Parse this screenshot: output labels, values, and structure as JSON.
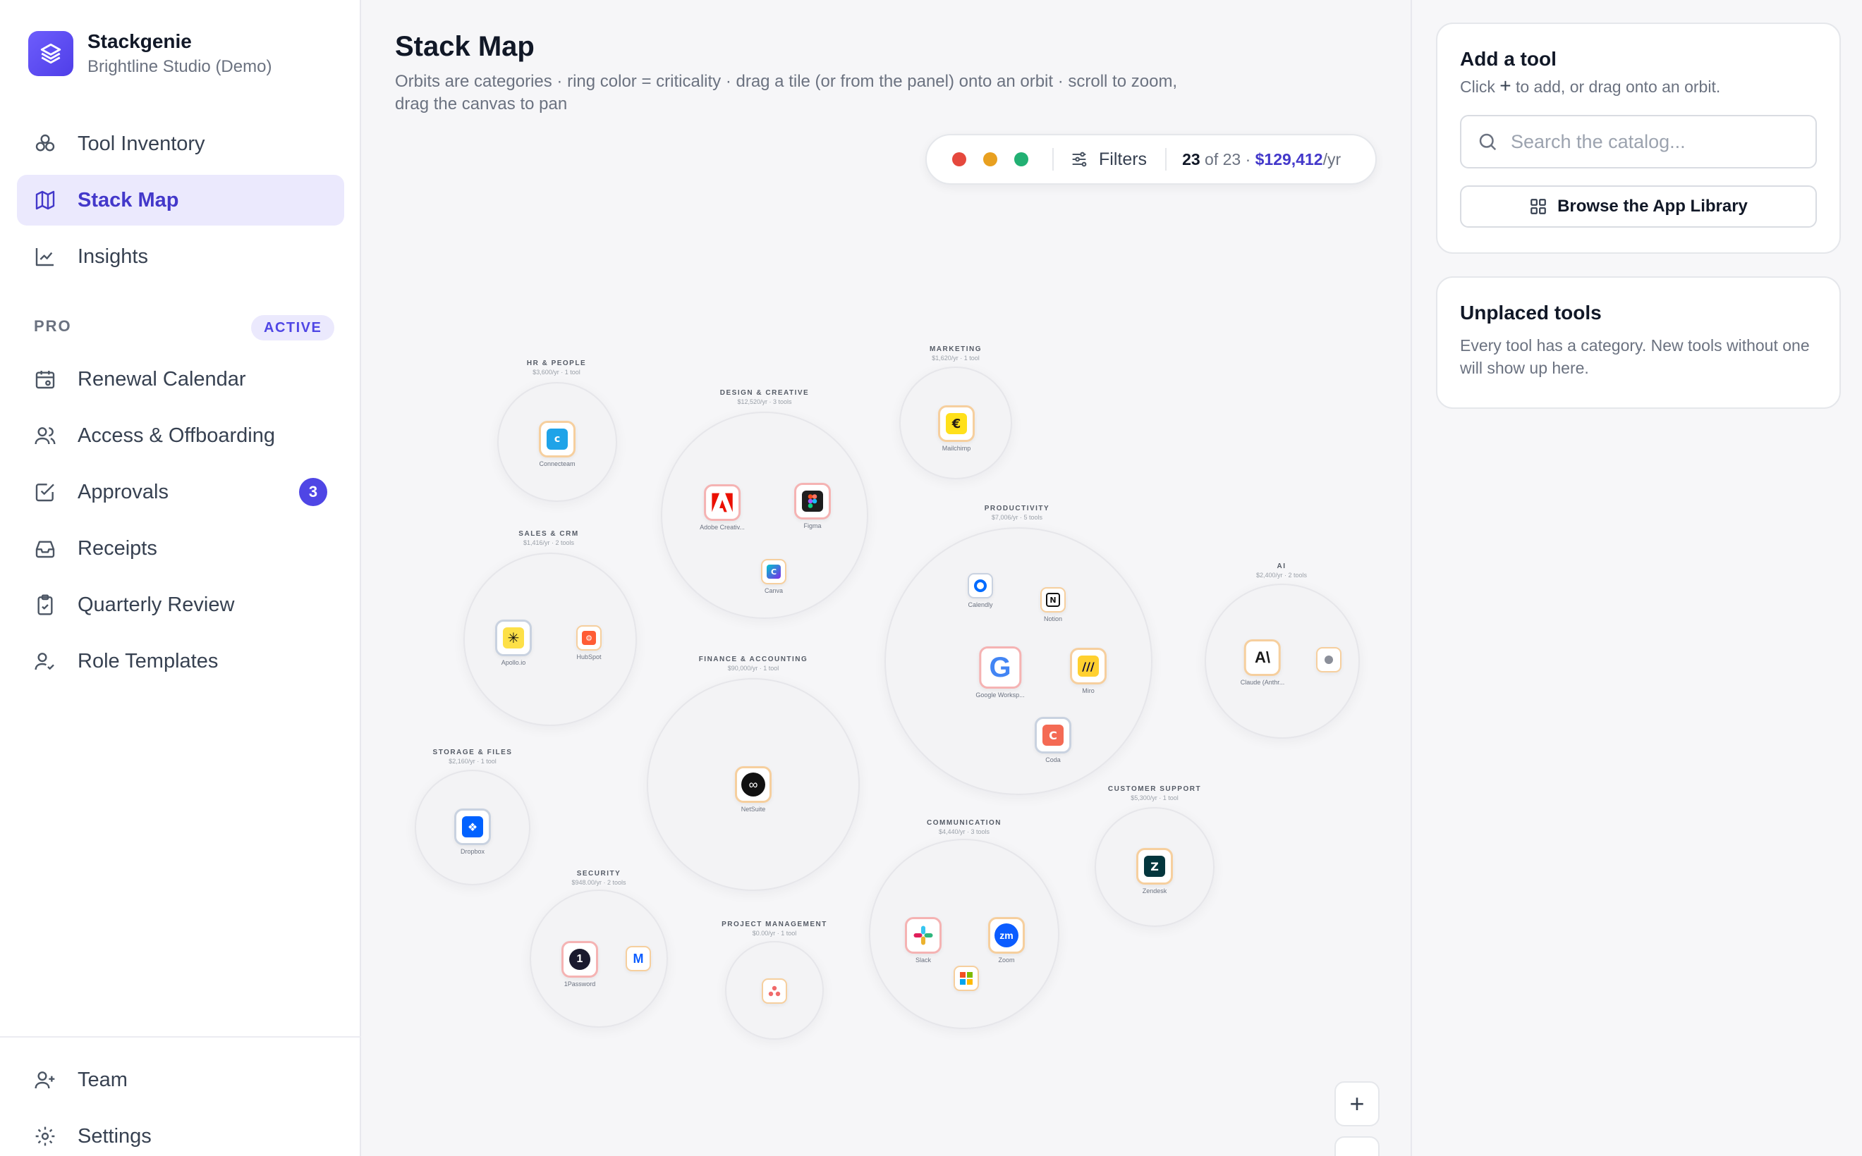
{
  "brand": {
    "name": "Stackgenie",
    "workspace": "Brightline Studio (Demo)"
  },
  "nav_main": [
    {
      "label": "Tool Inventory",
      "icon": "layers-circles-icon"
    },
    {
      "label": "Stack Map",
      "icon": "map-icon",
      "active": true
    },
    {
      "label": "Insights",
      "icon": "line-chart-icon"
    }
  ],
  "pro": {
    "label": "PRO",
    "status": "ACTIVE"
  },
  "nav_pro": [
    {
      "label": "Renewal Calendar",
      "icon": "calendar-icon"
    },
    {
      "label": "Access & Offboarding",
      "icon": "users-icon"
    },
    {
      "label": "Approvals",
      "icon": "check-square-icon",
      "badge": "3"
    },
    {
      "label": "Receipts",
      "icon": "inbox-icon"
    },
    {
      "label": "Quarterly Review",
      "icon": "clipboard-icon"
    },
    {
      "label": "Role Templates",
      "icon": "user-check-icon"
    }
  ],
  "nav_bottom": [
    {
      "label": "Team",
      "icon": "user-plus-icon"
    },
    {
      "label": "Settings",
      "icon": "gear-icon"
    }
  ],
  "main": {
    "title": "Stack Map",
    "subtitle": "Orbits are categories · ring color = criticality · drag a tile (or from the panel) onto an orbit · scroll to zoom, drag the canvas to pan"
  },
  "toolbar": {
    "dots": [
      "#e5483d",
      "#e8a020",
      "#22b073"
    ],
    "filters_label": "Filters",
    "shown": "23",
    "of_total": " of 23 · ",
    "cost": "$129,412",
    "per": "/yr"
  },
  "categories": [
    {
      "name": "HR & PEOPLE",
      "meta": "$3,600/yr · 1 tool"
    },
    {
      "name": "DESIGN & CREATIVE",
      "meta": "$12,520/yr · 3 tools"
    },
    {
      "name": "MARKETING",
      "meta": "$1,620/yr · 1 tool"
    },
    {
      "name": "SALES & CRM",
      "meta": "$1,416/yr · 2 tools"
    },
    {
      "name": "PRODUCTIVITY",
      "meta": "$7,006/yr · 5 tools"
    },
    {
      "name": "AI",
      "meta": "$2,400/yr · 2 tools"
    },
    {
      "name": "FINANCE & ACCOUNTING",
      "meta": "$90,000/yr · 1 tool"
    },
    {
      "name": "STORAGE & FILES",
      "meta": "$2,160/yr · 1 tool"
    },
    {
      "name": "CUSTOMER SUPPORT",
      "meta": "$5,300/yr · 1 tool"
    },
    {
      "name": "COMMUNICATION",
      "meta": "$4,440/yr · 3 tools"
    },
    {
      "name": "SECURITY",
      "meta": "$948.00/yr · 2 tools"
    },
    {
      "name": "PROJECT MANAGEMENT",
      "meta": "$0.00/yr · 1 tool"
    }
  ],
  "tools": {
    "connecteam": "Connecteam",
    "adobe": "Adobe Creativ...",
    "figma": "Figma",
    "canva": "Canva",
    "mailchimp": "Mailchimp",
    "apollo": "Apollo.io",
    "hubspot": "HubSpot",
    "calendly": "Calendly",
    "notion": "Notion",
    "google": "Google Worksp...",
    "miro": "Miro",
    "coda": "Coda",
    "claude": "Claude (Anthr...",
    "netsuite": "NetSuite",
    "dropbox": "Dropbox",
    "zendesk": "Zendesk",
    "slack": "Slack",
    "zoom": "Zoom",
    "onepassword": "1Password"
  },
  "zoom": {
    "in": "+"
  },
  "panel": {
    "add_title": "Add a tool",
    "add_sub_pre": "Click",
    "add_sub_plus": "+",
    "add_sub_post": "to add, or drag onto an orbit.",
    "search_placeholder": "Search the catalog...",
    "browse_label": "Browse the App Library",
    "unplaced_title": "Unplaced tools",
    "unplaced_sub": "Every tool has a category. New tools without one will show up here."
  }
}
